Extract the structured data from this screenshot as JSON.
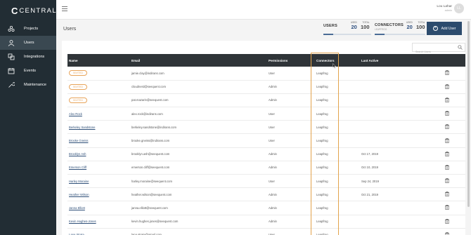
{
  "app": {
    "logo_mark": "C",
    "logo_text": "CENTRAL"
  },
  "sidebar": {
    "items": [
      {
        "label": "Projects",
        "icon": "projects-icon"
      },
      {
        "label": "Users",
        "icon": "users-icon",
        "active": true
      },
      {
        "label": "Integrations",
        "icon": "integrations-icon"
      },
      {
        "label": "Events",
        "icon": "calendar-icon"
      },
      {
        "label": "Maintenance",
        "icon": "wrench-icon"
      }
    ]
  },
  "topbar": {
    "user_name": "Lou Lahar",
    "user_role": "admin",
    "avatar_initials": "LL"
  },
  "header": {
    "title": "Users",
    "users": {
      "label": "USERS",
      "used_label": "USED",
      "total_label": "TOTAL",
      "used": "20",
      "total": "100",
      "fraction": 0.2
    },
    "connectors": {
      "label": "CONNECTORS",
      "sub": "LEAPFROG",
      "used_label": "USED",
      "total_label": "TOTAL",
      "used": "20",
      "total": "100",
      "fraction": 0.2
    },
    "add_user_label": "Add User"
  },
  "search": {
    "placeholder": "Search Users"
  },
  "table": {
    "columns": [
      "Name",
      "Email",
      "Permissions",
      "Connectors",
      "Last Active",
      ""
    ],
    "invited_label": "INVITED",
    "rows": [
      {
        "name": "",
        "invited": true,
        "email": "jamie.clay@indirans.com",
        "permission": "User",
        "connector": "Leapfrog",
        "last_active": ""
      },
      {
        "name": "",
        "invited": true,
        "email": "cloudnerd@seequent.com",
        "permission": "Admin",
        "connector": "Leapfrog",
        "last_active": ""
      },
      {
        "name": "",
        "invited": true,
        "email": "pat.mazarin@seequent.com",
        "permission": "Admin",
        "connector": "Leapfrog",
        "last_active": ""
      },
      {
        "name": "Alex Rock",
        "invited": false,
        "email": "alex.rock@indirans.com",
        "permission": "User",
        "connector": "Leapfrog",
        "last_active": ""
      },
      {
        "name": "Berkeley Sandstone",
        "invited": false,
        "email": "berkeley.sandstone@indirans.com",
        "permission": "User",
        "connector": "Leapfrog",
        "last_active": ""
      },
      {
        "name": "Brooke Gneiss",
        "invited": false,
        "email": "brooke.gneiss@indirans.com",
        "permission": "User",
        "connector": "Leapfrog",
        "last_active": ""
      },
      {
        "name": "Brooklyn Ash",
        "invited": false,
        "email": "brooklyn.ash@seequent.com",
        "permission": "Admin",
        "connector": "Leapfrog",
        "last_active": "Oct 17, 2019"
      },
      {
        "name": "Emerson Cliff",
        "invited": false,
        "email": "emerson.cliff@seequent.com",
        "permission": "Admin",
        "connector": "Leapfrog",
        "last_active": "Oct 10, 2019"
      },
      {
        "name": "Harley Moraine",
        "invited": false,
        "email": "harley.moraine@seequent.com",
        "permission": "User",
        "connector": "Leapfrog",
        "last_active": "Sep 24, 2019"
      },
      {
        "name": "Heather Wilson",
        "invited": false,
        "email": "heather.wilson@seequent.com",
        "permission": "Admin",
        "connector": "Leapfrog",
        "last_active": "Oct 21, 2019"
      },
      {
        "name": "Janna Elliott",
        "invited": false,
        "email": "janna.elliott@seequent.com",
        "permission": "Admin",
        "connector": "Leapfrog",
        "last_active": ""
      },
      {
        "name": "Kevin Hughes-Jones",
        "invited": false,
        "email": "kevin.hughes.jones@seequent.com",
        "permission": "Admin",
        "connector": "Leapfrog",
        "last_active": ""
      },
      {
        "name": "Lana Strata",
        "invited": false,
        "email": "lana.strata@gmail.com",
        "permission": "User",
        "connector": "Leapfrog",
        "last_active": ""
      }
    ]
  },
  "colors": {
    "sidebar_bg": "#222d34",
    "accent": "#2c4b6d",
    "invited": "#e8a45a",
    "highlight": "#e3a34c"
  }
}
